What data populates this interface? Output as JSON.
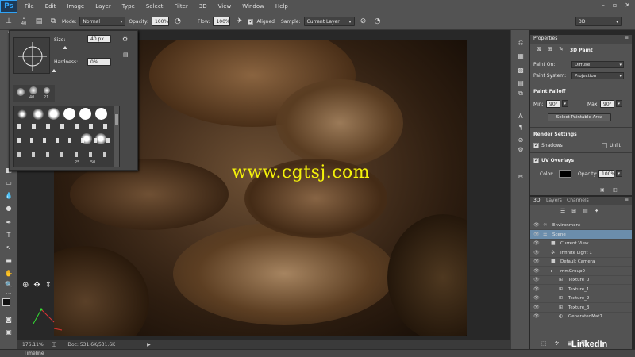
{
  "app": {
    "logo": "Ps"
  },
  "menu": [
    "File",
    "Edit",
    "Image",
    "Layer",
    "Type",
    "Select",
    "Filter",
    "3D",
    "View",
    "Window",
    "Help"
  ],
  "window_controls": [
    "–",
    "▫",
    "✕"
  ],
  "options_bar": {
    "brush_size": "40",
    "mode_label": "Mode:",
    "mode_value": "Normal",
    "opacity_label": "Opacity:",
    "opacity_value": "100%",
    "flow_label": "Flow:",
    "flow_value": "100%",
    "aligned_label": "Aligned",
    "aligned_checked": true,
    "sample_label": "Sample:",
    "sample_value": "Current Layer",
    "workspace_value": "3D"
  },
  "brush_popup": {
    "size_label": "Size:",
    "size_value": "40 px",
    "hardness_label": "Hardness:",
    "hardness_value": "0%",
    "size_fraction": 0.2,
    "hardness_fraction": 0.0,
    "recent_sizes": [
      "40",
      "21"
    ],
    "preset_sizes": [
      "25",
      "50"
    ]
  },
  "watermark": "www.cgtsj.com",
  "status": {
    "zoom": "176.11%",
    "doc": "Doc: 531.6K/531.6K"
  },
  "timeline": {
    "label": "Timeline"
  },
  "properties": {
    "tab_label": "Properties",
    "mode_label": "3D Paint",
    "paint_on_label": "Paint On:",
    "paint_on_value": "Diffuse",
    "paint_system_label": "Paint System:",
    "paint_system_value": "Projection",
    "falloff_head": "Paint Falloff",
    "min_label": "Min:",
    "min_value": "90°",
    "max_label": "Max:",
    "max_value": "90°",
    "select_area_button": "Select Paintable Area",
    "render_head": "Render Settings",
    "shadows_label": "Shadows",
    "unlit_label": "Unlit",
    "uv_head": "UV Overlays",
    "color_label": "Color:",
    "uv_opacity_label": "Opacity:",
    "uv_opacity_value": "100%"
  },
  "panel3d": {
    "tabs": [
      "3D",
      "Layers",
      "Channels"
    ],
    "items": [
      {
        "name": "Environment",
        "icon": "☼",
        "indent": 0
      },
      {
        "name": "Scene",
        "icon": "☰",
        "indent": 0,
        "selected": true
      },
      {
        "name": "Current View",
        "icon": "■",
        "indent": 1
      },
      {
        "name": "Infinite Light 1",
        "icon": "✲",
        "indent": 1
      },
      {
        "name": "Default Camera",
        "icon": "■",
        "indent": 1
      },
      {
        "name": "mmGroup0",
        "icon": "▸",
        "indent": 1
      },
      {
        "name": "Texture_0",
        "icon": "⊞",
        "indent": 2
      },
      {
        "name": "Texture_1",
        "icon": "⊞",
        "indent": 2
      },
      {
        "name": "Texture_2",
        "icon": "⊞",
        "indent": 2
      },
      {
        "name": "Texture_3",
        "icon": "⊞",
        "indent": 2
      },
      {
        "name": "GeneratedMat7",
        "icon": "◐",
        "indent": 2
      }
    ]
  },
  "branding": "LinkedIn",
  "colors": {
    "selection": "#6b8dab",
    "watermark": "#f4f20a",
    "ui_dark": "#535353"
  }
}
